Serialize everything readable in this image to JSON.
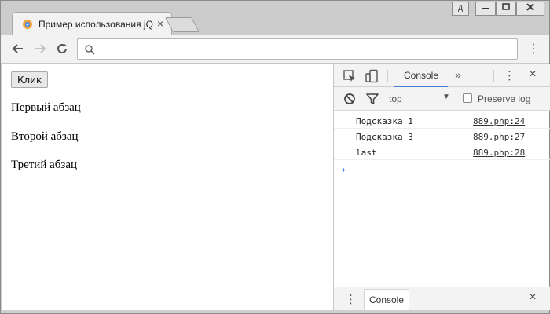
{
  "browser": {
    "tab_title": "Пример использования jQuery",
    "tab_close": "×",
    "window_user_button": "д",
    "address_value": "",
    "menu": "⋮"
  },
  "page": {
    "button_label": "Клик",
    "paragraphs": [
      "Первый абзац",
      "Второй абзац",
      "Третий абзац"
    ]
  },
  "devtools": {
    "tab_console": "Console",
    "more_tabs": "»",
    "menu": "⋮",
    "close": "×",
    "context": "top",
    "context_caret": "▼",
    "preserve_log_label": "Preserve log",
    "preserve_log_checked": false,
    "logs": [
      {
        "message": "Подсказка 1",
        "source": "889.php:24"
      },
      {
        "message": "Подсказка 3",
        "source": "889.php:27"
      },
      {
        "message": "last",
        "source": "889.php:28"
      }
    ],
    "prompt": "›",
    "drawer_menu": "⋮",
    "drawer_tab": "Console",
    "drawer_close": "×"
  },
  "colors": {
    "console_tab_underline": "#4a7bd4",
    "prompt": "#367cf1"
  },
  "icons": [
    "favicon-icon",
    "back-arrow-icon",
    "forward-arrow-icon",
    "reload-icon",
    "search-icon",
    "more-vert-icon",
    "inspect-element-icon",
    "device-toolbar-icon",
    "clear-console-icon",
    "filter-icon"
  ]
}
